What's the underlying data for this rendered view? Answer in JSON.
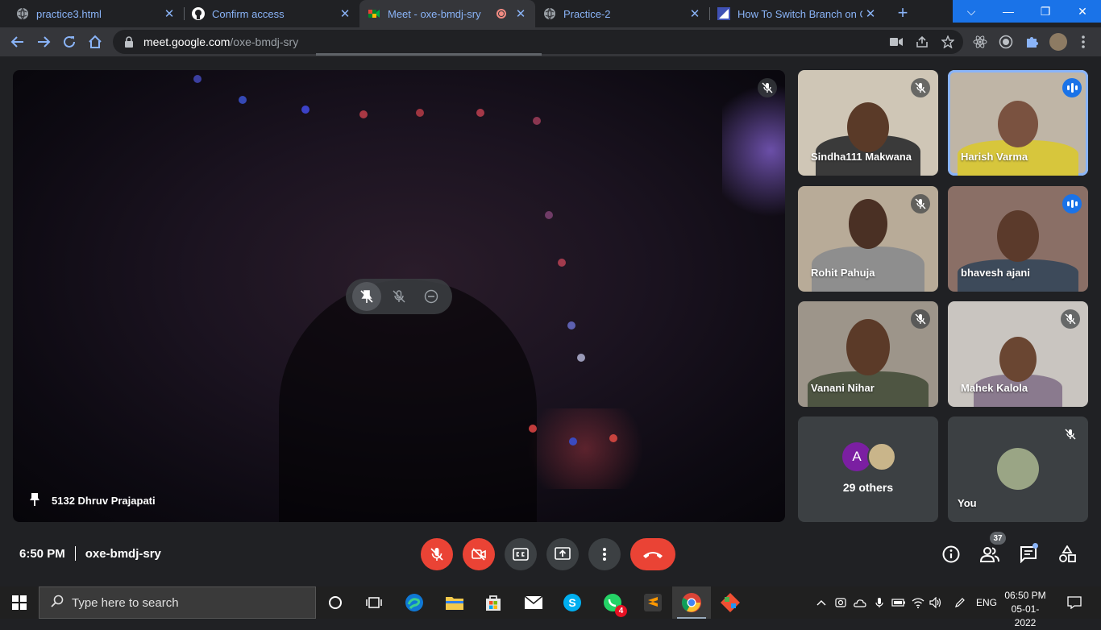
{
  "browser": {
    "tabs": [
      {
        "title": "practice3.html",
        "icon": "globe-icon"
      },
      {
        "title": "Confirm access",
        "icon": "github-icon"
      },
      {
        "title": "Meet - oxe-bmdj-sry",
        "icon": "meet-icon",
        "active": true
      },
      {
        "title": "Practice-2",
        "icon": "globe-icon"
      },
      {
        "title": "How To Switch Branch on Git",
        "icon": "article-icon"
      }
    ],
    "close_glyph": "✕",
    "new_tab_glyph": "+",
    "url_host": "meet.google.com",
    "url_path": "/oxe-bmdj-sry",
    "window_controls": {
      "tabsearch": "⌵",
      "minimize": "—",
      "restore": "❐",
      "close": "✕"
    }
  },
  "meet": {
    "main_participant": "5132 Dhruv Prajapati",
    "participants": [
      {
        "name": "Sindha111 Makwana",
        "muted": true
      },
      {
        "name": "Harish Varma",
        "muted": false,
        "speaking": true
      },
      {
        "name": "Rohit Pahuja",
        "muted": true
      },
      {
        "name": "bhavesh ajani",
        "muted": false
      },
      {
        "name": "Vanani Nihar",
        "muted": true
      },
      {
        "name": "Mahek Kalola",
        "muted": true
      }
    ],
    "others_count_label": "29 others",
    "others_avatar_letter": "A",
    "self_label": "You",
    "time": "6:50 PM",
    "meeting_code": "oxe-bmdj-sry",
    "people_count": "37"
  },
  "taskbar": {
    "search_placeholder": "Type here to search",
    "whatsapp_badge": "4",
    "language": "ENG",
    "clock_time": "06:50 PM",
    "clock_date": "05-01-2022"
  },
  "colors": {
    "accent_blue": "#8ab4f8",
    "meet_red": "#ea4335",
    "tile_bg": "#3c4043"
  }
}
